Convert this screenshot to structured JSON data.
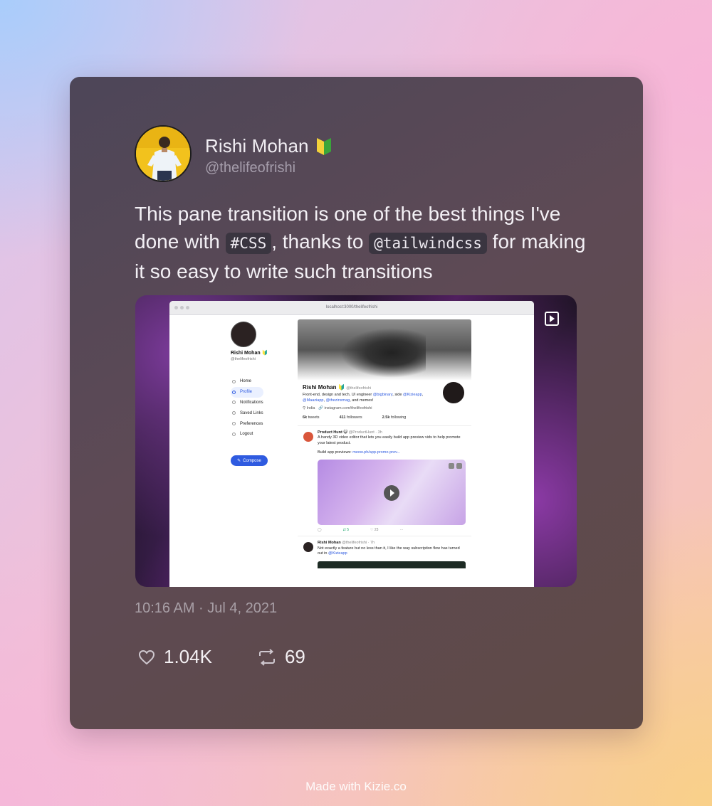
{
  "author": {
    "name": "Rishi Mohan",
    "badge": "🔰",
    "handle": "@thelifeofrishi"
  },
  "tweet": {
    "text_part1": "This pane transition is one of the best things I've done with ",
    "hashtag": "#CSS",
    "text_part2": ", thanks to ",
    "mention": "@tailwindcss",
    "text_part3": " for making it so easy to write such transitions",
    "timestamp": "10:16 AM · Jul 4, 2021",
    "likes": "1.04K",
    "retweets": "69"
  },
  "media_screenshot": {
    "url": "localhost:3000/thelifeofrishi",
    "sidebar": {
      "name": "Rishi Mohan 🔰",
      "handle": "@thelifeofrishi",
      "nav": [
        "Home",
        "Profile",
        "Notifications",
        "Saved Links",
        "Preferences",
        "Logout"
      ],
      "active_nav": "Profile",
      "compose_label": "Compose"
    },
    "profile": {
      "name": "Rishi Mohan 🔰",
      "handle": "@thelifeofrishi",
      "bio_1": "Front-end, design and tech, UI engineer ",
      "bio_link_1": "@bigbinary",
      "bio_2": ", side ",
      "bio_link_2": "@Kizieapp",
      "bio_3": ",",
      "bio_link_3": "@Maaziapp",
      "bio_4": ", ",
      "bio_link_4": "@thezinxmag",
      "bio_5": ", and memes!",
      "location": "India",
      "website": "instagram.com/thelifeofrishi",
      "tweets_count": "6k",
      "tweets_label": "tweets",
      "followers_count": "411",
      "followers_label": "followers",
      "following_count": "2.5k",
      "following_label": "following"
    },
    "tweet1": {
      "author": "Product Hunt 😺",
      "handle": "@ProductHunt · 3h",
      "text": "A handy 3D video editor that lets you easily build app preview vids to help promote your latest product.",
      "link_prefix": "Build app previews:",
      "link": "meow.ph/app-promo-prev...",
      "retweets": "5",
      "likes": "23",
      "more": "···"
    },
    "tweet2": {
      "author": "Rishi Mohan",
      "handle": "@thelifeofrishi · 7h",
      "text": "Not exactly a feature but no less than it, I like the way subscription flow has turned out in ",
      "link": "@Kizieapp"
    }
  },
  "footer": "Made with Kizie.co",
  "colors": {
    "card_bg": "#54495a",
    "accent_blue": "#2f5be0",
    "text_primary": "#f1eef3",
    "text_muted": "#a59dab"
  }
}
